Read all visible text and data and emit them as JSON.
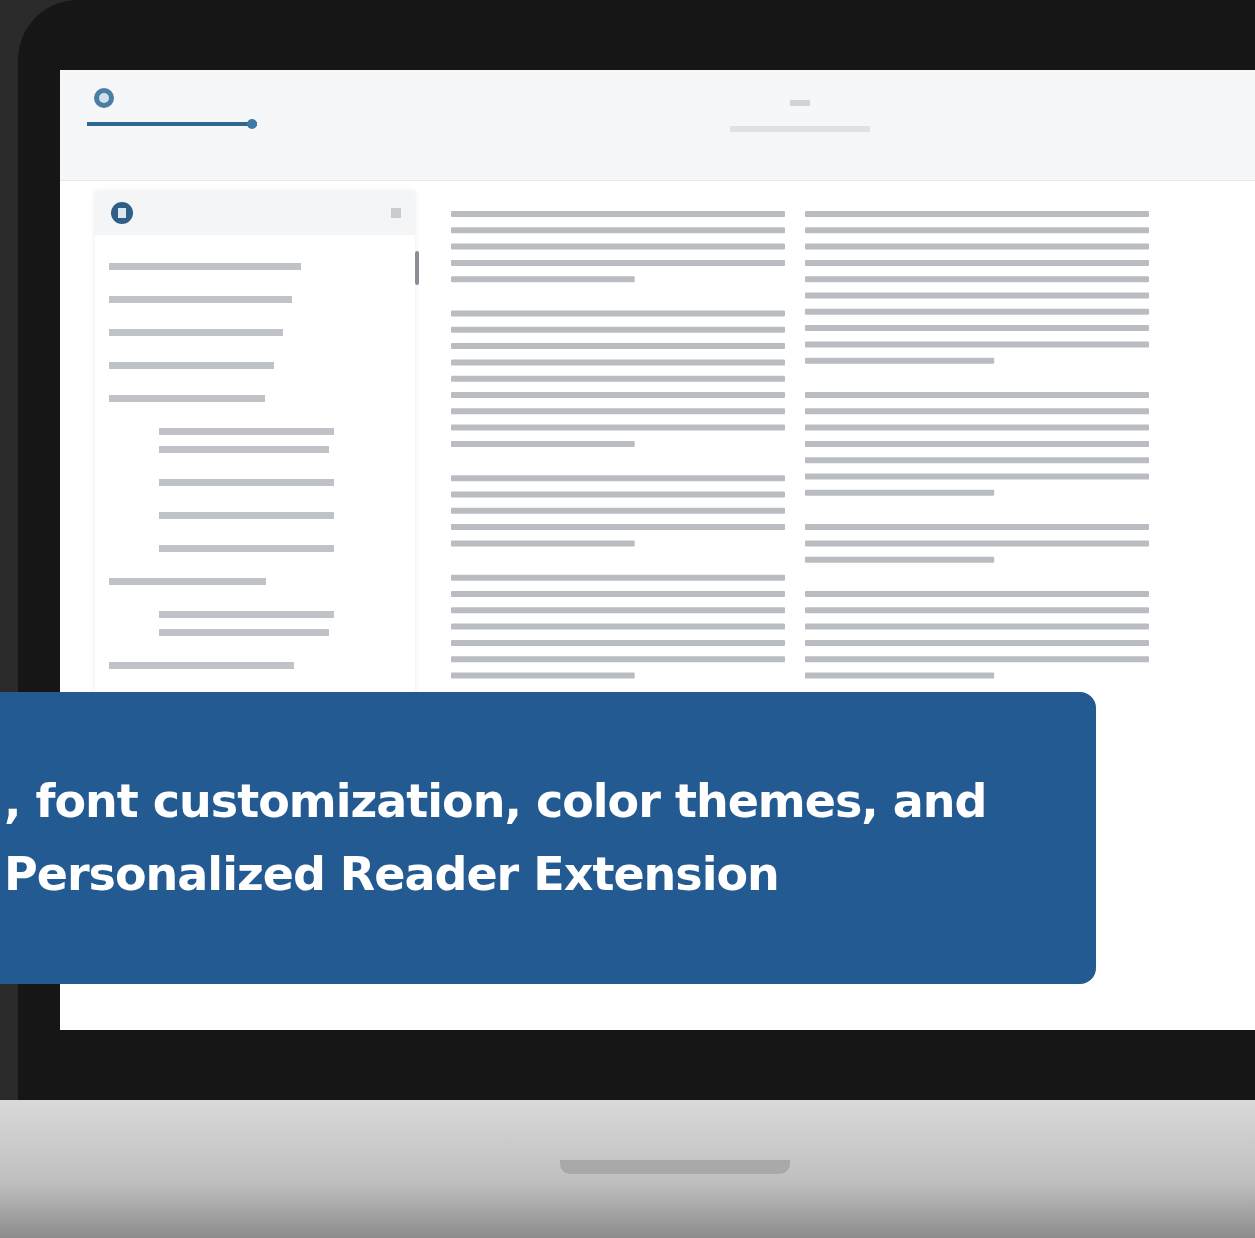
{
  "toolbar": {
    "slider": {
      "level": 1
    }
  },
  "banner": {
    "lines": [
      ", font customization, color themes, and",
      "Personalized Reader Extension"
    ]
  }
}
